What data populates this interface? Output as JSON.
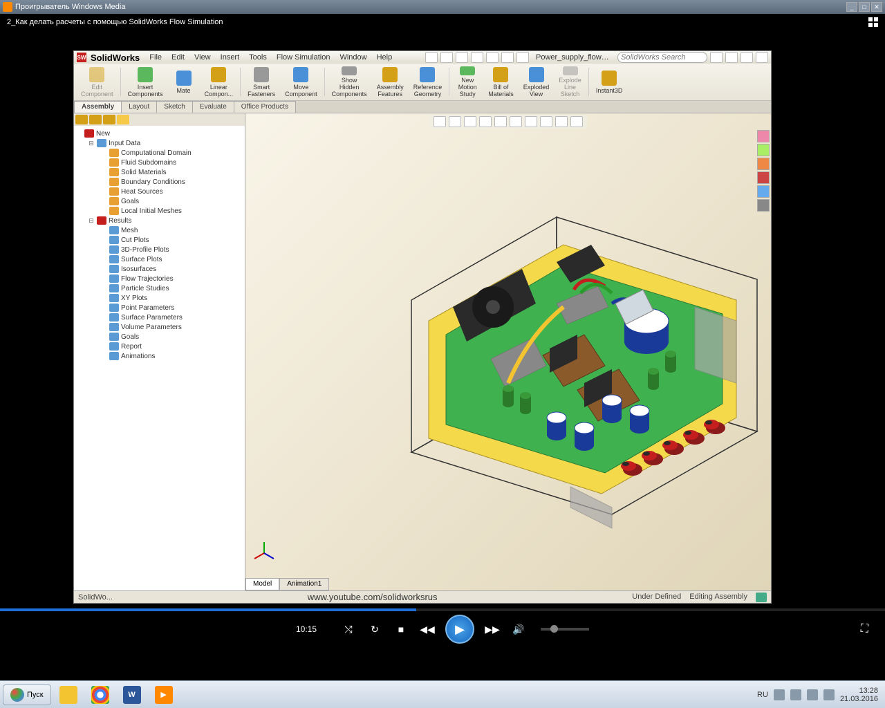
{
  "wmp": {
    "title": "Проигрыватель Windows Media",
    "video_title": "2_Как делать расчеты с помощью SolidWorks Flow Simulation",
    "time": "10:15"
  },
  "sw": {
    "brand": "SolidWorks",
    "menus": [
      "File",
      "Edit",
      "View",
      "Insert",
      "Tools",
      "Flow Simulation",
      "Window",
      "Help"
    ],
    "doc": "Power_supply_flow_analysis...",
    "search_ph": "SolidWorks Search",
    "ribbon": [
      {
        "l": "Edit\nComponent",
        "d": true
      },
      {
        "l": "Insert\nComponents"
      },
      {
        "l": "Mate"
      },
      {
        "l": "Linear\nCompon..."
      },
      {
        "l": "Smart\nFasteners"
      },
      {
        "l": "Move\nComponent"
      },
      {
        "l": "Show\nHidden\nComponents"
      },
      {
        "l": "Assembly\nFeatures"
      },
      {
        "l": "Reference\nGeometry"
      },
      {
        "l": "New\nMotion\nStudy"
      },
      {
        "l": "Bill of\nMaterials"
      },
      {
        "l": "Exploded\nView"
      },
      {
        "l": "Explode\nLine\nSketch",
        "d": true
      },
      {
        "l": "Instant3D"
      }
    ],
    "tabs": [
      "Assembly",
      "Layout",
      "Sketch",
      "Evaluate",
      "Office Products"
    ],
    "tree": {
      "root": "New",
      "input": "Input Data",
      "input_items": [
        "Computational Domain",
        "Fluid Subdomains",
        "Solid Materials",
        "Boundary Conditions",
        "Heat Sources",
        "Goals",
        "Local Initial Meshes"
      ],
      "results": "Results",
      "results_items": [
        "Mesh",
        "Cut Plots",
        "3D-Profile Plots",
        "Surface Plots",
        "Isosurfaces",
        "Flow Trajectories",
        "Particle Studies",
        "XY Plots",
        "Point Parameters",
        "Surface Parameters",
        "Volume Parameters",
        "Goals",
        "Report",
        "Animations"
      ]
    },
    "bottom_tabs": [
      "Model",
      "Animation1"
    ],
    "status": {
      "watermark": "www.youtube.com/solidworksrus",
      "under": "Under Defined",
      "mode": "Editing Assembly"
    }
  },
  "taskbar": {
    "start": "Пуск",
    "lang": "RU",
    "time": "13:28",
    "date": "21.03.2016"
  }
}
